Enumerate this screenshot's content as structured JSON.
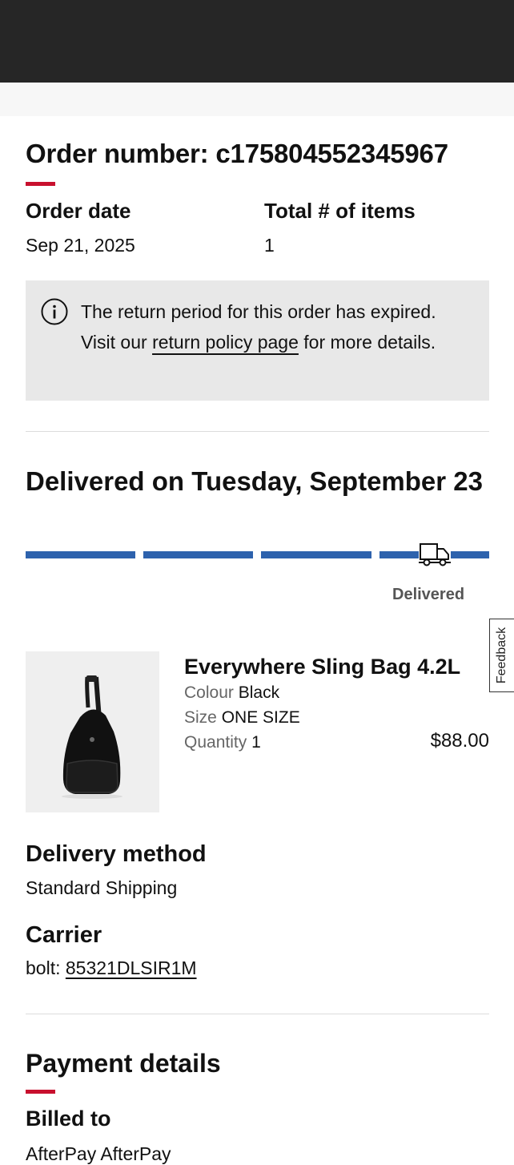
{
  "order": {
    "number_label": "Order number: c175804552345967",
    "date_label": "Order date",
    "date_value": "Sep 21, 2025",
    "items_label": "Total # of items",
    "items_value": "1"
  },
  "notice": {
    "text_before": "The return period for this order has expired. Visit our ",
    "link_text": "return policy page",
    "text_after": " for more details.",
    "icon": "info-icon"
  },
  "delivery": {
    "heading": "Delivered on Tuesday, September 23",
    "progress": {
      "steps_total": 4,
      "steps_completed": 4,
      "accent_color": "#2d62ad"
    },
    "status_label": "Delivered",
    "status_icon": "truck-icon"
  },
  "product": {
    "name": "Everywhere Sling Bag 4.2L",
    "colour_label": "Colour",
    "colour_value": "Black",
    "size_label": "Size",
    "size_value": "ONE SIZE",
    "quantity_label": "Quantity",
    "quantity_value": "1",
    "price": "$88.00"
  },
  "delivery_method": {
    "title": "Delivery method",
    "value": "Standard Shipping"
  },
  "carrier": {
    "title": "Carrier",
    "prefix": "bolt: ",
    "tracking_number": "85321DLSIR1M"
  },
  "payment": {
    "title": "Payment details",
    "billed_to_label": "Billed to",
    "billed_to_value": "AfterPay AfterPay"
  },
  "feedback": {
    "label": "Feedback"
  },
  "colors": {
    "accent_red": "#c8102e",
    "header_dark": "#262626"
  }
}
